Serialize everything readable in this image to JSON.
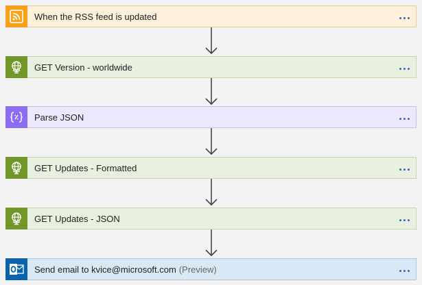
{
  "steps": [
    {
      "title": "When the RSS feed is updated",
      "suffix": "",
      "icon": "rss-icon",
      "icon_bg": "#f7a11a",
      "card_bg": "#fef0da",
      "card_border": "#f2c98c"
    },
    {
      "title": "GET Version - worldwide",
      "suffix": "",
      "icon": "globe-icon",
      "icon_bg": "#709727",
      "card_bg": "#eaf0e0",
      "card_border": "#c6d5ad"
    },
    {
      "title": "Parse JSON",
      "suffix": "",
      "icon": "curly-braces-icon",
      "icon_bg": "#8c6cf0",
      "card_bg": "#ece7fc",
      "card_border": "#c9bdf4"
    },
    {
      "title": "GET Updates - Formatted",
      "suffix": "",
      "icon": "globe-icon",
      "icon_bg": "#709727",
      "card_bg": "#eaf0e0",
      "card_border": "#c6d5ad"
    },
    {
      "title": "GET Updates - JSON",
      "suffix": "",
      "icon": "globe-icon",
      "icon_bg": "#709727",
      "card_bg": "#eaf0e0",
      "card_border": "#c6d5ad"
    },
    {
      "title": "Send email to kvice@microsoft.com",
      "suffix": "(Preview)",
      "icon": "outlook-icon",
      "icon_bg": "#0a64ad",
      "card_bg": "#d9e8f5",
      "card_border": "#a9c8e4"
    }
  ],
  "more_menu_icon": "ellipsis-icon",
  "connector_color": "#444444"
}
